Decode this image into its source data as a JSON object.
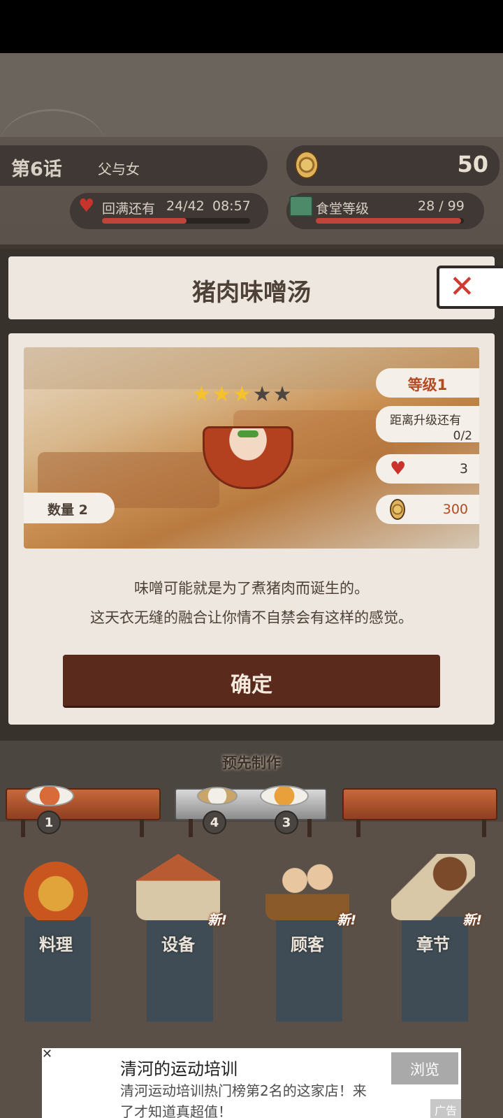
{
  "hud": {
    "chapter_num": "第6话",
    "chapter_title": "父与女",
    "coins": "50",
    "heart_label": "回满还有",
    "heart_count": "24/42",
    "heart_timer": "08:57",
    "heart_fill_fraction": 0.57,
    "canteen_label": "食堂等级",
    "canteen_value": "28 / 99",
    "canteen_fill_fraction": 0.98
  },
  "dialog": {
    "title": "猪肉味噌汤",
    "close_icon": "close-x-icon",
    "rating": {
      "filled": 3,
      "total": 5
    },
    "quantity": "数量 2",
    "level": "等级1",
    "upgrade_label": "距离升级还有",
    "upgrade_progress": "0/2",
    "hearts": "3",
    "price": "300",
    "desc_line1": "味噌可能就是为了煮猪肉而诞生的。",
    "desc_line2": "这天衣无缝的融合让你情不自禁会有这样的感觉。",
    "confirm_label": "确定"
  },
  "prep": {
    "label": "预先制作",
    "counts": [
      "1",
      "4",
      "3"
    ]
  },
  "menu": [
    {
      "label": "料理",
      "new": ""
    },
    {
      "label": "设备",
      "new": "新!"
    },
    {
      "label": "顾客",
      "new": "新!"
    },
    {
      "label": "章节",
      "new": "新!"
    }
  ],
  "ad": {
    "title": "清河的运动培训",
    "body": "清河运动培训热门榜第2名的这家店！来了才知道真超值！",
    "button": "浏览",
    "tag": "广告"
  },
  "colors": {
    "accent_red": "#c0443a",
    "confirm_button": "#5a2a1c",
    "level_text": "#b44a22",
    "star_on": "#f5c22b"
  }
}
